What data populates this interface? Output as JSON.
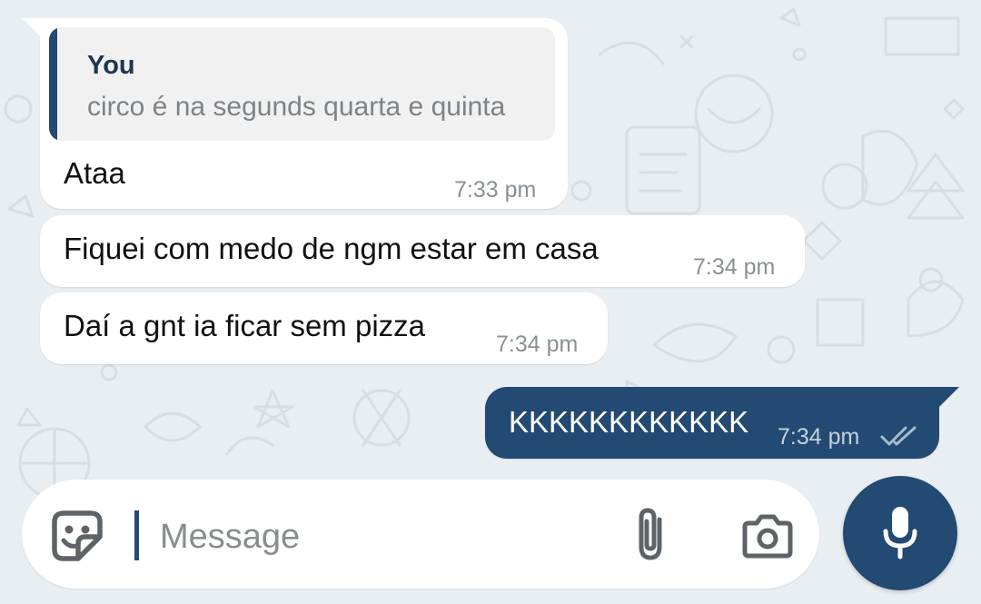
{
  "theme": {
    "wallpaper_color": "#e9eef3",
    "accent_color": "#224a72",
    "bubble_in_color": "#ffffff",
    "bubble_out_color": "#224a72"
  },
  "messages": [
    {
      "direction": "incoming",
      "reply_to": {
        "author": "You",
        "text": "circo é na segunds quarta e quinta"
      },
      "text": "Ataa",
      "time": "7:33 pm"
    },
    {
      "direction": "incoming",
      "text": "Fiquei com medo de ngm estar em casa",
      "time": "7:34 pm"
    },
    {
      "direction": "incoming",
      "text": "Daí a gnt ia ficar sem pizza",
      "time": "7:34 pm"
    },
    {
      "direction": "outgoing",
      "text": "KKKKKKKKKKKK",
      "time": "7:34 pm",
      "status": "read-double-check-icon"
    }
  ],
  "composer": {
    "placeholder": "Message",
    "value": "",
    "icons": [
      "sticker-icon",
      "paperclip-icon",
      "camera-icon",
      "microphone-icon"
    ]
  }
}
